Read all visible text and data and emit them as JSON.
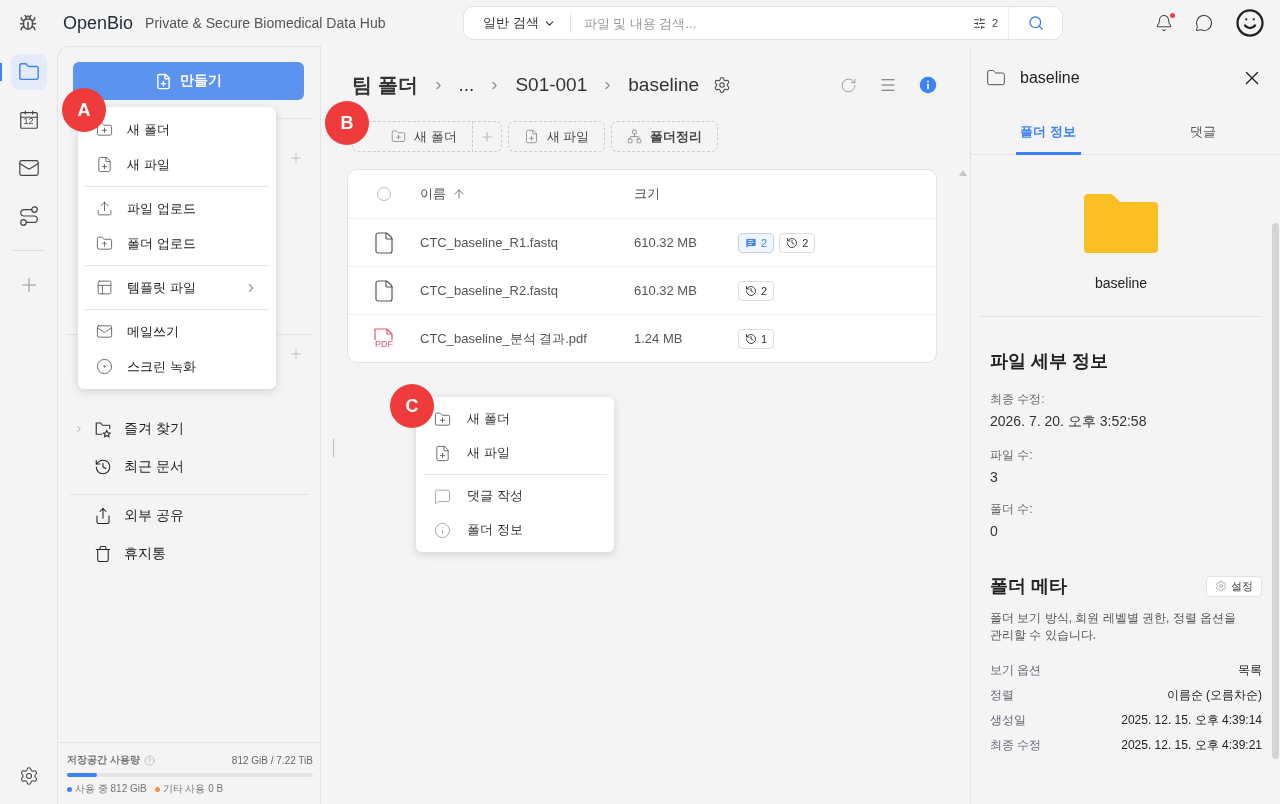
{
  "app": {
    "name": "OpenBio",
    "tagline": "Private & Secure Biomedical Data Hub"
  },
  "search": {
    "scope": "일반 검색",
    "placeholder": "파일 및 내용 검색...",
    "filter_count": "2"
  },
  "header": {
    "notification_unread": true
  },
  "rail": {
    "items": [
      {
        "kind": "files",
        "selected": true
      },
      {
        "kind": "calendar",
        "selected": false,
        "day": "12"
      },
      {
        "kind": "mail",
        "selected": false
      },
      {
        "kind": "route",
        "selected": false
      }
    ]
  },
  "sidebar": {
    "create_button": "만들기",
    "items": [
      {
        "kind": "favorites",
        "label": "즐겨 찾기",
        "expandable": true
      },
      {
        "kind": "recent",
        "label": "최근 문서",
        "expandable": false
      },
      {
        "kind": "share",
        "label": "외부 공유",
        "expandable": false
      },
      {
        "kind": "trash",
        "label": "휴지통",
        "expandable": false
      }
    ],
    "storage": {
      "label": "저장공간 사용량",
      "total": "812 GiB / 7.22 TiB",
      "level": 0.12,
      "legend": [
        {
          "label": "사용 중 812 GiB",
          "color": "#3b82f6"
        },
        {
          "label": "기타 사용 0 B",
          "color": "#fb923c"
        }
      ]
    }
  },
  "create_menu": {
    "groups": [
      [
        {
          "kind": "folder",
          "label": "새 폴더",
          "submenu": false
        },
        {
          "kind": "file",
          "label": "새 파일",
          "submenu": false
        }
      ],
      [
        {
          "kind": "upload",
          "label": "파일 업로드",
          "submenu": false
        },
        {
          "kind": "folder_upload",
          "label": "폴더 업로드",
          "submenu": false
        }
      ],
      [
        {
          "kind": "template",
          "label": "템플릿 파일",
          "submenu": true
        }
      ],
      [
        {
          "kind": "mail",
          "label": "메일쓰기",
          "submenu": false
        },
        {
          "kind": "record",
          "label": "스크린 녹화",
          "submenu": false
        }
      ]
    ]
  },
  "main": {
    "breadcrumb": [
      "팀 폴더",
      "...",
      "S01-001",
      "baseline"
    ],
    "info_open": true,
    "toolbar": [
      {
        "kind": "new_folder",
        "label": "새 폴더"
      },
      {
        "kind": "new_file",
        "label": "새 파일"
      },
      {
        "kind": "organize",
        "label": "폴더정리"
      }
    ],
    "table": {
      "columns": [
        "이름",
        "크기"
      ],
      "select_all": false,
      "rows": [
        {
          "kind": "file",
          "name": "CTC_baseline_R1.fastq",
          "size": "610.32 MB",
          "comments": "2",
          "versions": "2"
        },
        {
          "kind": "file",
          "name": "CTC_baseline_R2.fastq",
          "size": "610.32 MB",
          "versions": "2"
        },
        {
          "kind": "pdf",
          "icon_text": "PDF",
          "name": "CTC_baseline_분석 결과.pdf",
          "size": "1.24 MB",
          "versions": "1"
        }
      ]
    }
  },
  "context_menu": {
    "groups": [
      [
        {
          "kind": "folder",
          "label": "새 폴더"
        },
        {
          "kind": "file",
          "label": "새 파일"
        }
      ],
      [
        {
          "kind": "comment",
          "label": "댓글 작성"
        },
        {
          "kind": "info",
          "label": "폴더 정보"
        }
      ]
    ]
  },
  "details": {
    "title": "baseline",
    "tabs": [
      {
        "label": "폴더 정보",
        "selected": true
      },
      {
        "label": "댓글",
        "selected": false
      }
    ],
    "folder_name": "baseline",
    "file_details": {
      "heading": "파일 세부 정보",
      "fields": [
        {
          "label": "최종 수정:",
          "value": "2026. 7. 20. 오후 3:52:58"
        },
        {
          "label": "파일 수:",
          "value": "3"
        },
        {
          "label": "폴더 수:",
          "value": "0"
        }
      ]
    },
    "meta": {
      "heading": "폴더 메타",
      "settings_button": "설정",
      "description": "폴더 보기 방식, 회원 레벨별 권한, 정렬 옵션을 관리할 수 있습니다.",
      "rows": [
        {
          "label": "보기 옵션",
          "value": "목록"
        },
        {
          "label": "정렬",
          "value": "이름순 (오름차순)"
        },
        {
          "label": "생성일",
          "value": "2025. 12. 15. 오후 4:39:14"
        },
        {
          "label": "최종 수정",
          "value": "2025. 12. 15. 오후 4:39:21"
        }
      ]
    }
  },
  "annotations": [
    {
      "label": "A"
    },
    {
      "label": "B"
    },
    {
      "label": "C"
    }
  ]
}
